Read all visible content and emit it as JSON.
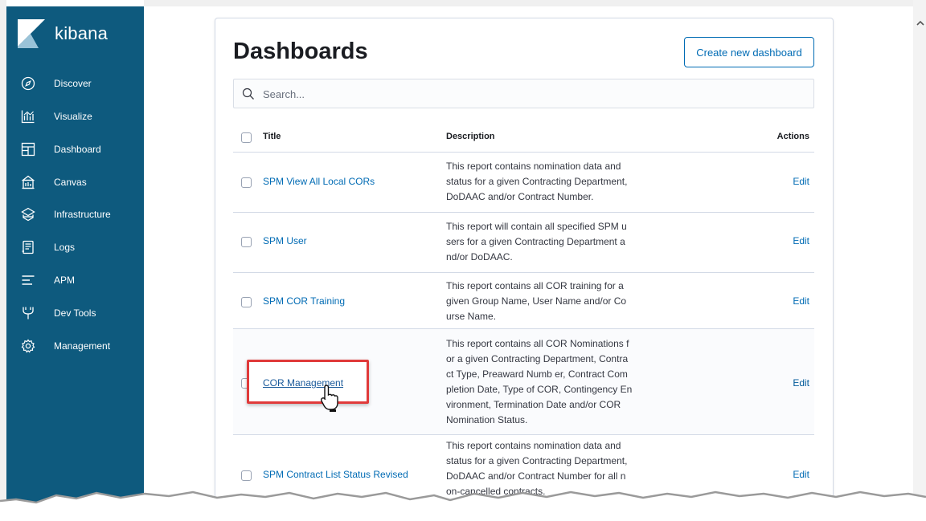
{
  "app": {
    "name": "kibana"
  },
  "sidebar": {
    "items": [
      {
        "label": "Discover",
        "icon": "compass-icon"
      },
      {
        "label": "Visualize",
        "icon": "visualize-icon"
      },
      {
        "label": "Dashboard",
        "icon": "dashboard-icon"
      },
      {
        "label": "Canvas",
        "icon": "canvas-icon"
      },
      {
        "label": "Infrastructure",
        "icon": "infrastructure-icon"
      },
      {
        "label": "Logs",
        "icon": "logs-icon"
      },
      {
        "label": "APM",
        "icon": "apm-icon"
      },
      {
        "label": "Dev Tools",
        "icon": "devtools-icon"
      },
      {
        "label": "Management",
        "icon": "gear-icon"
      }
    ]
  },
  "main": {
    "title": "Dashboards",
    "create_button": "Create new dashboard",
    "search": {
      "placeholder": "Search...",
      "value": ""
    },
    "table": {
      "columns": {
        "title": "Title",
        "description": "Description",
        "actions": "Actions"
      },
      "rows": [
        {
          "title": "SPM View All Local CORs",
          "description_lines": [
            "This report contains nomination data and",
            "status for a given Contracting Department,",
            "DoDAAC and/or Contract Number."
          ],
          "action": "Edit"
        },
        {
          "title": "SPM User",
          "description_lines": [
            "This report will contain all specified SPM u",
            "sers for a given Contracting Department a",
            "nd/or DoDAAC."
          ],
          "action": "Edit"
        },
        {
          "title": "SPM COR Training",
          "description_lines": [
            "This report contains all COR training for a",
            "given Group Name, User Name and/or Co",
            "urse Name."
          ],
          "action": "Edit"
        },
        {
          "title": "COR Management",
          "description_lines": [
            "This report contains all COR Nominations f",
            "or a given Contracting Department, Contra",
            "ct Type, Preaward Numb er, Contract Com",
            "pletion Date, Type of COR, Contingency En",
            "vironment, Termination Date and/or COR",
            "Nomination Status."
          ],
          "action": "Edit"
        },
        {
          "title": "SPM Contract List Status Revised",
          "description_lines": [
            "This report contains nomination data and",
            "status for a given Contracting Department,",
            "DoDAAC and/or Contract Number for all n",
            "on-cancelled contracts."
          ],
          "action": "Edit"
        }
      ]
    }
  },
  "colors": {
    "sidebar": "#0e5a7e",
    "link": "#006bb4",
    "highlight": "#e03a3a"
  }
}
